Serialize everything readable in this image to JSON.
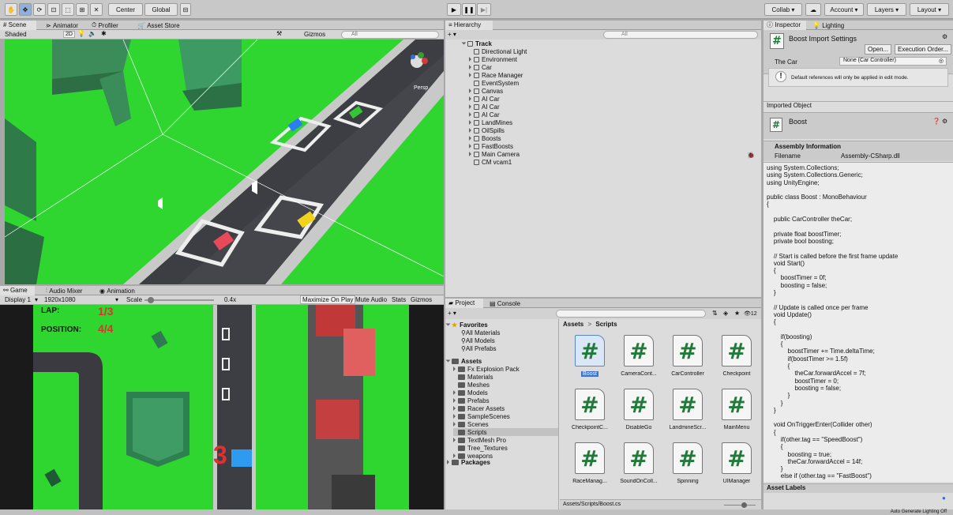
{
  "toolbar": {
    "center_label": "Center",
    "global_label": "Global",
    "collab_label": "Collab ▾",
    "account_label": "Account",
    "layers_label": "Layers",
    "layout_label": "Layout"
  },
  "scene": {
    "tabs": [
      "Scene",
      "Animator",
      "Profiler",
      "Asset Store"
    ],
    "shading": "Shaded",
    "mode_2d": "2D",
    "gizmos_label": "Gizmos",
    "search_placeholder": "All",
    "persp_label": "Persp"
  },
  "game": {
    "tabs": [
      "Game",
      "Audio Mixer",
      "Animation"
    ],
    "display": "Display 1",
    "resolution": "1920x1080",
    "scale_label": "Scale",
    "scale_value": "0.4x",
    "scale_level": 0.05,
    "maximize_label": "Maximize On Play",
    "mute_label": "Mute Audio",
    "stats_label": "Stats",
    "gizmos_label": "Gizmos",
    "hud": {
      "lap_label": "LAP:",
      "lap_value": "1/3",
      "position_label": "POSITION:",
      "position_value": "4/4",
      "countdown": "3"
    }
  },
  "hierarchy": {
    "title": "Hierarchy",
    "search_placeholder": "All",
    "root": "Track",
    "items": [
      {
        "label": "Directional Light",
        "expandable": false
      },
      {
        "label": "Environment",
        "expandable": true
      },
      {
        "label": "Car",
        "expandable": true
      },
      {
        "label": "Race Manager",
        "expandable": true
      },
      {
        "label": "EventSystem",
        "expandable": false
      },
      {
        "label": "Canvas",
        "expandable": true
      },
      {
        "label": "AI Car",
        "expandable": true
      },
      {
        "label": "AI Car",
        "expandable": true
      },
      {
        "label": "AI Car",
        "expandable": true
      },
      {
        "label": "LandMines",
        "expandable": true
      },
      {
        "label": "OilSpills",
        "expandable": true
      },
      {
        "label": "Boosts",
        "expandable": true
      },
      {
        "label": "FastBoosts",
        "expandable": true
      },
      {
        "label": "Main Camera",
        "expandable": true
      },
      {
        "label": "CM vcam1",
        "expandable": false
      }
    ]
  },
  "project": {
    "tabs": [
      "Project",
      "Console"
    ],
    "hidden_count": "12",
    "favorites_label": "Favorites",
    "favorites": [
      "All Materials",
      "All Models",
      "All Prefabs"
    ],
    "assets_label": "Assets",
    "folders": [
      "Fx Explosion Pack",
      "Materials",
      "Meshes",
      "Models",
      "Prefabs",
      "Racer Assets",
      "SampleScenes",
      "Scenes",
      "Scripts",
      "TextMesh Pro",
      "Tree_Textures",
      "weapons"
    ],
    "packages_label": "Packages",
    "breadcrumb_root": "Assets",
    "breadcrumb_sep": ">",
    "breadcrumb_leaf": "Scripts",
    "scripts": [
      "Boost",
      "CameraCont...",
      "CarController",
      "Checkpoint",
      "CheckpointC...",
      "DisableGo",
      "LandmineScr...",
      "MainMenu",
      "RaceManag...",
      "SoundOnColl...",
      "Spinning",
      "UIManager"
    ],
    "footer_path": "Assets/Scripts/Boost.cs"
  },
  "inspector": {
    "tabs": [
      "Inspector",
      "Lighting"
    ],
    "header_title": "Boost Import Settings",
    "open_label": "Open...",
    "exec_order_label": "Execution Order...",
    "field_label": "The Car",
    "field_value": "None (Car Controller)",
    "info_text": "Default references will only be applied in edit mode.",
    "imported_object_label": "Imported Object",
    "object_name": "Boost",
    "assembly_header": "Assembly Information",
    "filename_label": "Filename",
    "filename_value": "Assembly-CSharp.dll",
    "code": "using System.Collections;\nusing System.Collections.Generic;\nusing UnityEngine;\n\npublic class Boost : MonoBehaviour\n{\n\n    public CarController theCar;\n\n    private float boostTimer;\n    private bool boosting;\n\n    // Start is called before the first frame update\n    void Start()\n    {\n        boostTimer = 0f;\n        boosting = false;\n    }\n\n    // Update is called once per frame\n    void Update()\n    {\n\n        if(boosting)\n        {\n            boostTimer += Time.deltaTime;\n            if(boostTimer >= 1.5f)\n            {\n                theCar.forwardAccel = 7f;\n                boostTimer = 0;\n                boosting = false;\n            }\n        }\n    }\n\n    void OnTriggerEnter(Collider other)\n    {\n        if(other.tag == \"SpeedBoost\")\n        {\n            boosting = true;\n            theCar.forwardAccel = 14f;\n        }\n        else if (other.tag == \"FastBoost\")",
    "asset_labels": "Asset Labels"
  },
  "status": {
    "text": "Auto Generate Lighting Off"
  }
}
